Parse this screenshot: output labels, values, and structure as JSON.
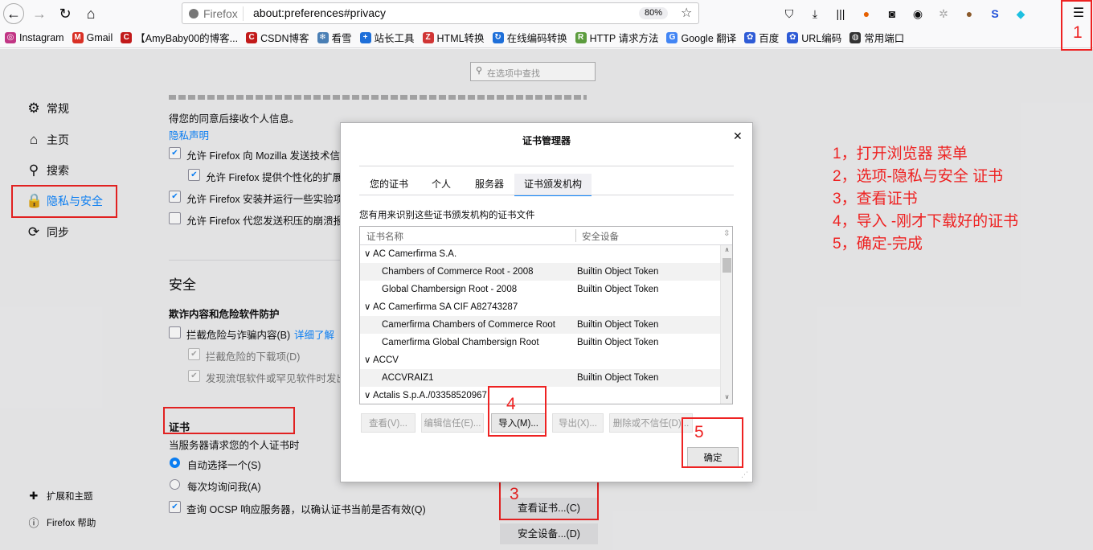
{
  "toolbar": {
    "brand": "Firefox",
    "url": "about:preferences#privacy",
    "zoom": "80%"
  },
  "bookmarks": [
    {
      "label": "Instagram",
      "icon": "instagram-icon",
      "color": "#c13584"
    },
    {
      "label": "Gmail",
      "icon": "gmail-icon",
      "color": "#d93025"
    },
    {
      "label": "【AmyBaby00的博客...",
      "icon": "csdn-icon",
      "color": "#c21a1a"
    },
    {
      "label": "CSDN博客",
      "icon": "csdn-icon",
      "color": "#c21a1a"
    },
    {
      "label": "看雪",
      "icon": "snowflake-icon",
      "color": "#4a7fb5"
    },
    {
      "label": "站长工具",
      "icon": "plus-icon",
      "color": "#1e6fd9"
    },
    {
      "label": "HTML转换",
      "icon": "z-icon",
      "color": "#d03535"
    },
    {
      "label": "在线编码转换",
      "icon": "refresh-icon",
      "color": "#1e6fd9"
    },
    {
      "label": "HTTP 请求方法",
      "icon": "runoob-icon",
      "color": "#5c9c3e"
    },
    {
      "label": "Google 翻译",
      "icon": "translate-icon",
      "color": "#4285f4"
    },
    {
      "label": "百度",
      "icon": "paw-icon",
      "color": "#2e5bd6"
    },
    {
      "label": "URL编码",
      "icon": "paw-icon",
      "color": "#2e5bd6"
    },
    {
      "label": "常用端口",
      "icon": "globe-icon",
      "color": "#333333"
    }
  ],
  "search": {
    "placeholder": "在选项中查找"
  },
  "sidebar": {
    "items": [
      {
        "label": "常规"
      },
      {
        "label": "主页"
      },
      {
        "label": "搜索"
      },
      {
        "label": "隐私与安全"
      },
      {
        "label": "同步"
      }
    ],
    "extensions": "扩展和主题",
    "help": "Firefox 帮助"
  },
  "privacy": {
    "intro": "得您的同意后接收个人信息。",
    "link": "隐私声明",
    "opt1": "允许 Firefox 向 Mozilla 发送技术信",
    "opt2": "允许 Firefox 提供个性化的扩展",
    "opt3": "允许 Firefox 安装并运行一些实验项",
    "opt4": "允许 Firefox 代您发送积压的崩溃报"
  },
  "security": {
    "heading": "安全",
    "subheading": "欺诈内容和危险软件防护",
    "block": "拦截危险与诈骗内容(B)",
    "learn_more": "详细了解",
    "block_downloads": "拦截危险的下载项(D)",
    "warn_unwanted": "发现流氓软件或罕见软件时发出"
  },
  "certs": {
    "heading": "证书",
    "desc": "当服务器请求您的个人证书时",
    "auto": "自动选择一个(S)",
    "ask": "每次均询问我(A)",
    "ocsp": "查询 OCSP 响应服务器，以确认证书当前是否有效(Q)",
    "view_btn": "查看证书...(C)",
    "devices_btn": "安全设备...(D)"
  },
  "dialog": {
    "title": "证书管理器",
    "tabs": [
      "您的证书",
      "个人",
      "服务器",
      "证书颁发机构"
    ],
    "desc": "您有用来识别这些证书颁发机构的证书文件",
    "col_name": "证书名称",
    "col_device": "安全设备",
    "rows": [
      {
        "name": "∨ AC Camerfirma S.A.",
        "device": ""
      },
      {
        "name": "Chambers of Commerce Root - 2008",
        "device": "Builtin Object Token"
      },
      {
        "name": "Global Chambersign Root - 2008",
        "device": "Builtin Object Token"
      },
      {
        "name": "∨ AC Camerfirma SA CIF A82743287",
        "device": ""
      },
      {
        "name": "Camerfirma Chambers of Commerce Root",
        "device": "Builtin Object Token"
      },
      {
        "name": "Camerfirma Global Chambersign Root",
        "device": "Builtin Object Token"
      },
      {
        "name": "∨ ACCV",
        "device": ""
      },
      {
        "name": "ACCVRAIZ1",
        "device": "Builtin Object Token"
      },
      {
        "name": "∨ Actalis S.p.A./03358520967",
        "device": ""
      }
    ],
    "btn_view": "查看(V)...",
    "btn_edit": "编辑信任(E)...",
    "btn_import": "导入(M)...",
    "btn_export": "导出(X)...",
    "btn_delete": "删除或不信任(D)...",
    "btn_ok": "确定"
  },
  "annotations": {
    "markers": [
      "1",
      "3",
      "4",
      "5"
    ],
    "steps": [
      "1，打开浏览器 菜单",
      "2，选项-隐私与安全    证书",
      "3，查看证书",
      "4，导入 -刚才下载好的证书",
      "5，确定-完成"
    ]
  }
}
